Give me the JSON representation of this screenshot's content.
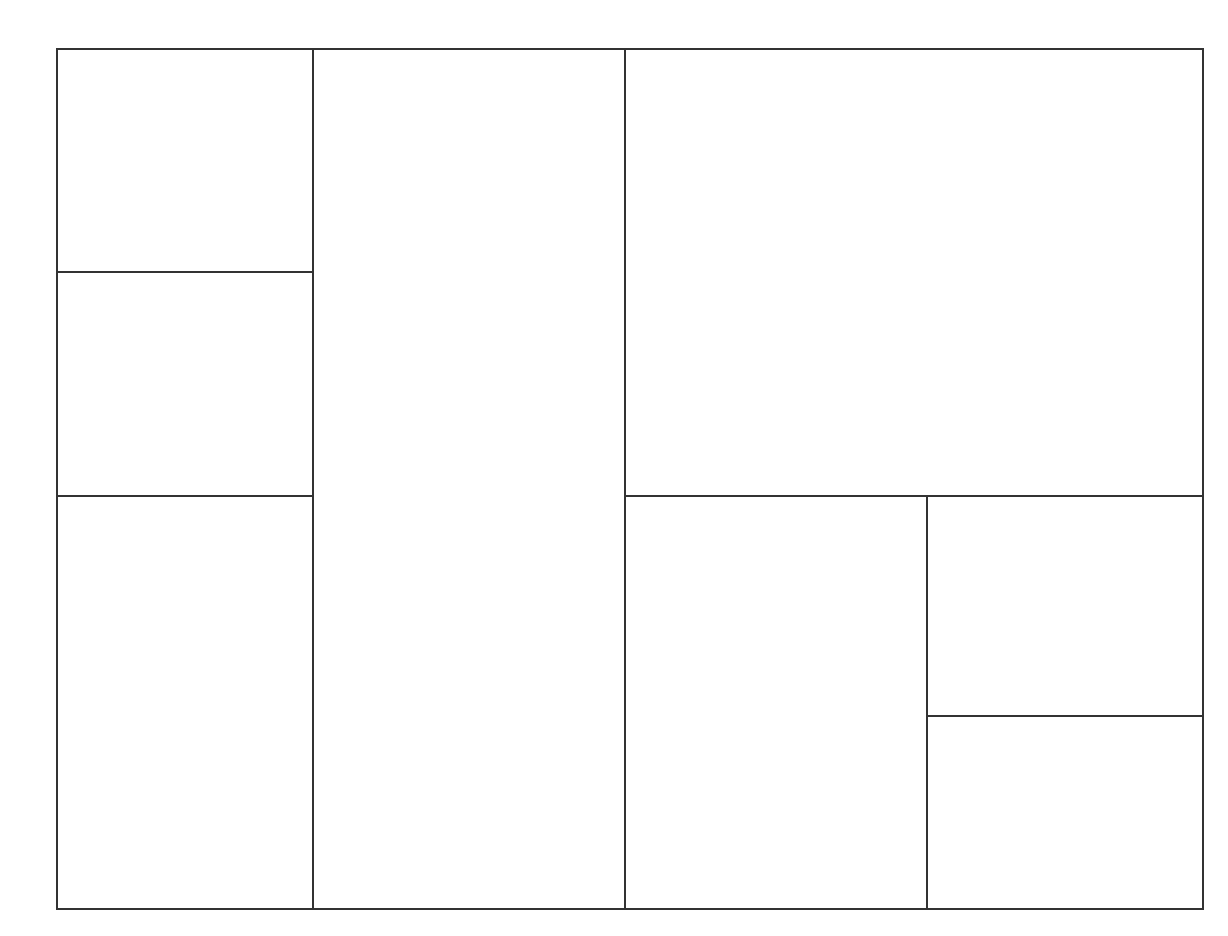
{
  "diagram": {
    "type": "rectangular-partition",
    "stroke_color": "#333333",
    "background_color": "#ffffff",
    "panels": [
      {
        "id": "top-left"
      },
      {
        "id": "mid-left"
      },
      {
        "id": "bottom-left"
      },
      {
        "id": "center"
      },
      {
        "id": "top-right"
      },
      {
        "id": "bottom-mid-right"
      },
      {
        "id": "right-upper"
      },
      {
        "id": "right-lower"
      }
    ]
  }
}
